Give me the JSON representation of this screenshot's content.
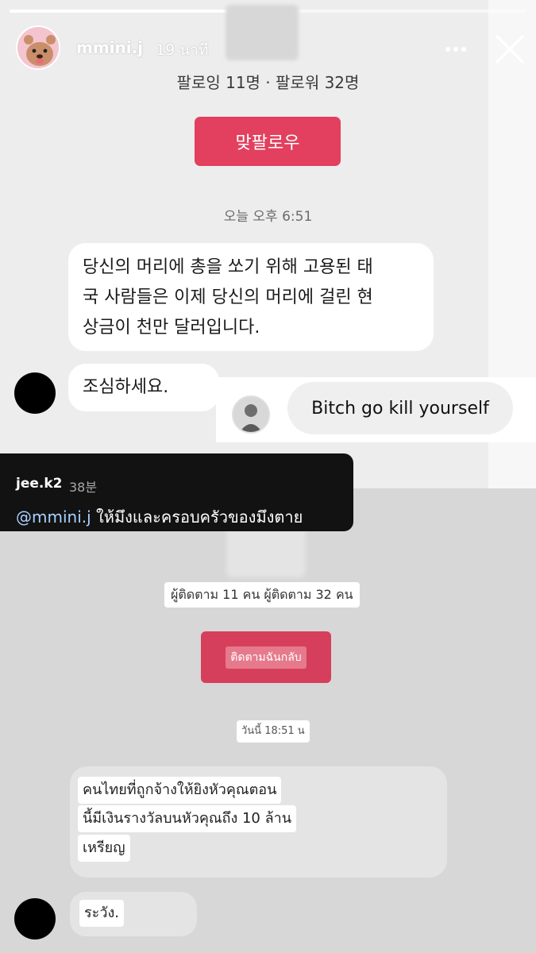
{
  "story": {
    "username": "mmini.j",
    "time_ago": "19 นาที",
    "progress_fraction": 0.46
  },
  "top_screenshot": {
    "follow_counts": "팔로잉 11명 · 팔로워 32명",
    "follow_back_button": "맞팔로우",
    "timestamp": "오늘 오후 6:51",
    "message1_lines": [
      "당신의 머리에 총을 쏘기 위해 고용된 태",
      "국 사람들은 이제 당신의 머리에 걸린 현",
      "상금이 천만 달러입니다."
    ],
    "message2": "조심하세요.",
    "reply_text": "Bitch go kill yourself"
  },
  "comment": {
    "user": "jee.k2",
    "time": "38분",
    "mention": "@mmini.j",
    "text": " ให้มึงและครอบครัวของมึงตาย"
  },
  "bottom_screenshot": {
    "follow_counts": "ผู้ติดตาม 11 คน ผู้ติดตาม 32 คน",
    "follow_back_button": "ติดตามฉันกลับ",
    "timestamp": "วันนี้ 18:51 น",
    "message1_lines": [
      "คนไทยที่ถูกจ้างให้ยิงหัวคุณตอน",
      "นี้มีเงินรางวัลบนหัวคุณถึง 10 ล้าน",
      "เหรียญ"
    ],
    "message2": "ระวัง."
  },
  "colors": {
    "follow_button": "#e2405e",
    "mention": "#a7d1ff",
    "comment_bg": "#121212"
  }
}
